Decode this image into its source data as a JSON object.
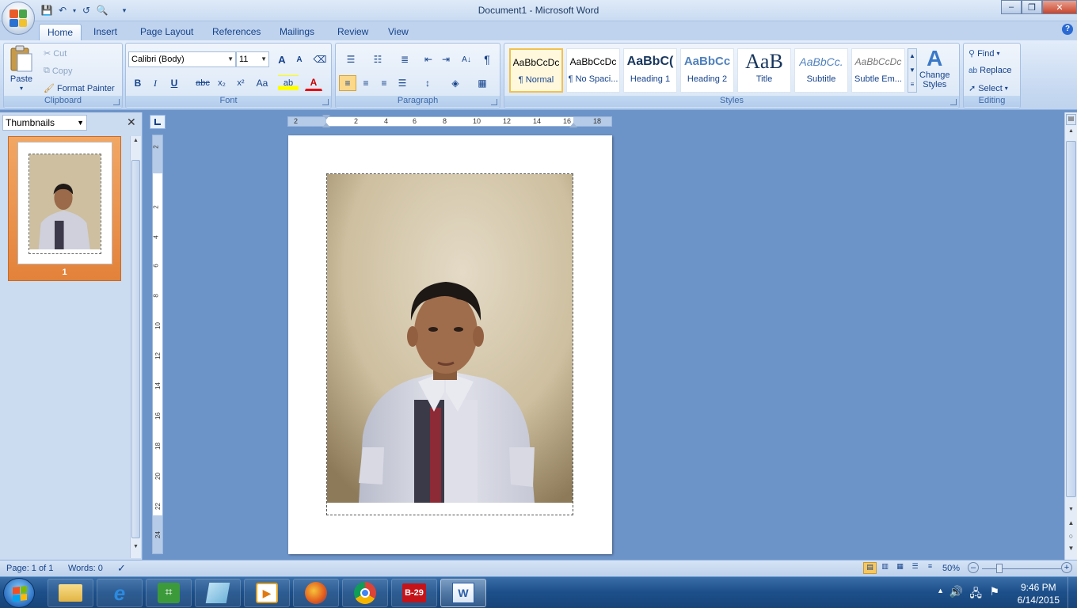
{
  "window": {
    "title": "Document1 - Microsoft Word",
    "minimize": "–",
    "restore": "❐",
    "close": "✕"
  },
  "qat": {
    "save": "💾",
    "undo": "↶",
    "redo": "↺",
    "preview": "🔍",
    "more": "▾"
  },
  "tabs": [
    "Home",
    "Insert",
    "Page Layout",
    "References",
    "Mailings",
    "Review",
    "View"
  ],
  "help": "?",
  "clipboard": {
    "paste": "Paste",
    "cut": "Cut",
    "copy": "Copy",
    "format_painter": "Format Painter",
    "label": "Clipboard"
  },
  "font": {
    "name": "Calibri (Body)",
    "size": "11",
    "grow": "A",
    "shrink": "A",
    "bold": "B",
    "italic": "I",
    "underline": "U",
    "strike": "abc",
    "sub": "x₂",
    "sup": "x²",
    "case": "Aa",
    "highlight": "ab",
    "color": "A",
    "label": "Font"
  },
  "paragraph": {
    "label": "Paragraph",
    "pilcrow": "¶",
    "sort": "A↓"
  },
  "styles": {
    "label": "Styles",
    "items": [
      {
        "sample": "AaBbCcDc",
        "name": "¶ Normal"
      },
      {
        "sample": "AaBbCcDc",
        "name": "¶ No Spaci..."
      },
      {
        "sample": "AaBbC(",
        "name": "Heading 1"
      },
      {
        "sample": "AaBbCc",
        "name": "Heading 2"
      },
      {
        "sample": "AaB",
        "name": "Title"
      },
      {
        "sample": "AaBbCc.",
        "name": "Subtitle"
      },
      {
        "sample": "AaBbCcDc",
        "name": "Subtle Em..."
      }
    ],
    "change_styles_line1": "Change",
    "change_styles_line2": "Styles"
  },
  "editing": {
    "label": "Editing",
    "find": "Find",
    "replace": "Replace",
    "select": "Select"
  },
  "thumbnails": {
    "select_value": "Thumbnails",
    "close": "✕",
    "page_number": "1"
  },
  "hruler_labels": [
    "2",
    "2",
    "4",
    "6",
    "8",
    "10",
    "12",
    "14",
    "16",
    "18"
  ],
  "vruler_labels": [
    "2",
    "2",
    "4",
    "6",
    "8",
    "10",
    "12",
    "14",
    "16",
    "18",
    "20",
    "22",
    "24"
  ],
  "status": {
    "page": "Page: 1 of 1",
    "words": "Words: 0",
    "zoom": "50%"
  },
  "clock": {
    "time": "9:46 PM",
    "date": "6/14/2015"
  },
  "taskbar": {
    "b29": "B-29"
  },
  "colors": {
    "ribbon_text": "#15428b",
    "accent_orange": "#e3823a",
    "taskbar": "#1c4f8a"
  }
}
